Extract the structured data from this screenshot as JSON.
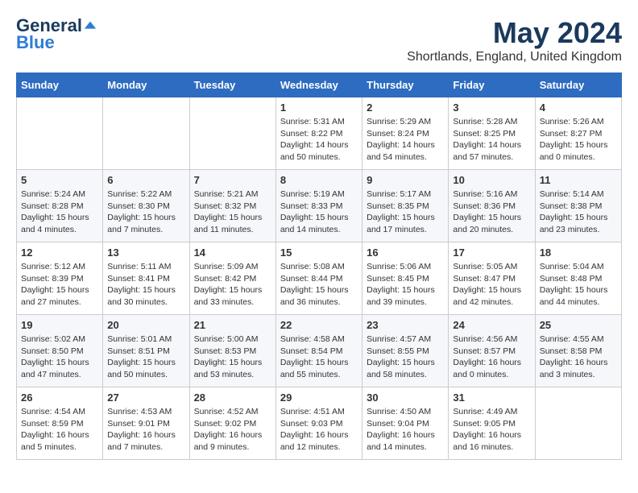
{
  "header": {
    "logo_line1": "General",
    "logo_line2": "Blue",
    "month_year": "May 2024",
    "location": "Shortlands, England, United Kingdom"
  },
  "weekdays": [
    "Sunday",
    "Monday",
    "Tuesday",
    "Wednesday",
    "Thursday",
    "Friday",
    "Saturday"
  ],
  "weeks": [
    [
      {
        "day": "",
        "info": ""
      },
      {
        "day": "",
        "info": ""
      },
      {
        "day": "",
        "info": ""
      },
      {
        "day": "1",
        "info": "Sunrise: 5:31 AM\nSunset: 8:22 PM\nDaylight: 14 hours\nand 50 minutes."
      },
      {
        "day": "2",
        "info": "Sunrise: 5:29 AM\nSunset: 8:24 PM\nDaylight: 14 hours\nand 54 minutes."
      },
      {
        "day": "3",
        "info": "Sunrise: 5:28 AM\nSunset: 8:25 PM\nDaylight: 14 hours\nand 57 minutes."
      },
      {
        "day": "4",
        "info": "Sunrise: 5:26 AM\nSunset: 8:27 PM\nDaylight: 15 hours\nand 0 minutes."
      }
    ],
    [
      {
        "day": "5",
        "info": "Sunrise: 5:24 AM\nSunset: 8:28 PM\nDaylight: 15 hours\nand 4 minutes."
      },
      {
        "day": "6",
        "info": "Sunrise: 5:22 AM\nSunset: 8:30 PM\nDaylight: 15 hours\nand 7 minutes."
      },
      {
        "day": "7",
        "info": "Sunrise: 5:21 AM\nSunset: 8:32 PM\nDaylight: 15 hours\nand 11 minutes."
      },
      {
        "day": "8",
        "info": "Sunrise: 5:19 AM\nSunset: 8:33 PM\nDaylight: 15 hours\nand 14 minutes."
      },
      {
        "day": "9",
        "info": "Sunrise: 5:17 AM\nSunset: 8:35 PM\nDaylight: 15 hours\nand 17 minutes."
      },
      {
        "day": "10",
        "info": "Sunrise: 5:16 AM\nSunset: 8:36 PM\nDaylight: 15 hours\nand 20 minutes."
      },
      {
        "day": "11",
        "info": "Sunrise: 5:14 AM\nSunset: 8:38 PM\nDaylight: 15 hours\nand 23 minutes."
      }
    ],
    [
      {
        "day": "12",
        "info": "Sunrise: 5:12 AM\nSunset: 8:39 PM\nDaylight: 15 hours\nand 27 minutes."
      },
      {
        "day": "13",
        "info": "Sunrise: 5:11 AM\nSunset: 8:41 PM\nDaylight: 15 hours\nand 30 minutes."
      },
      {
        "day": "14",
        "info": "Sunrise: 5:09 AM\nSunset: 8:42 PM\nDaylight: 15 hours\nand 33 minutes."
      },
      {
        "day": "15",
        "info": "Sunrise: 5:08 AM\nSunset: 8:44 PM\nDaylight: 15 hours\nand 36 minutes."
      },
      {
        "day": "16",
        "info": "Sunrise: 5:06 AM\nSunset: 8:45 PM\nDaylight: 15 hours\nand 39 minutes."
      },
      {
        "day": "17",
        "info": "Sunrise: 5:05 AM\nSunset: 8:47 PM\nDaylight: 15 hours\nand 42 minutes."
      },
      {
        "day": "18",
        "info": "Sunrise: 5:04 AM\nSunset: 8:48 PM\nDaylight: 15 hours\nand 44 minutes."
      }
    ],
    [
      {
        "day": "19",
        "info": "Sunrise: 5:02 AM\nSunset: 8:50 PM\nDaylight: 15 hours\nand 47 minutes."
      },
      {
        "day": "20",
        "info": "Sunrise: 5:01 AM\nSunset: 8:51 PM\nDaylight: 15 hours\nand 50 minutes."
      },
      {
        "day": "21",
        "info": "Sunrise: 5:00 AM\nSunset: 8:53 PM\nDaylight: 15 hours\nand 53 minutes."
      },
      {
        "day": "22",
        "info": "Sunrise: 4:58 AM\nSunset: 8:54 PM\nDaylight: 15 hours\nand 55 minutes."
      },
      {
        "day": "23",
        "info": "Sunrise: 4:57 AM\nSunset: 8:55 PM\nDaylight: 15 hours\nand 58 minutes."
      },
      {
        "day": "24",
        "info": "Sunrise: 4:56 AM\nSunset: 8:57 PM\nDaylight: 16 hours\nand 0 minutes."
      },
      {
        "day": "25",
        "info": "Sunrise: 4:55 AM\nSunset: 8:58 PM\nDaylight: 16 hours\nand 3 minutes."
      }
    ],
    [
      {
        "day": "26",
        "info": "Sunrise: 4:54 AM\nSunset: 8:59 PM\nDaylight: 16 hours\nand 5 minutes."
      },
      {
        "day": "27",
        "info": "Sunrise: 4:53 AM\nSunset: 9:01 PM\nDaylight: 16 hours\nand 7 minutes."
      },
      {
        "day": "28",
        "info": "Sunrise: 4:52 AM\nSunset: 9:02 PM\nDaylight: 16 hours\nand 9 minutes."
      },
      {
        "day": "29",
        "info": "Sunrise: 4:51 AM\nSunset: 9:03 PM\nDaylight: 16 hours\nand 12 minutes."
      },
      {
        "day": "30",
        "info": "Sunrise: 4:50 AM\nSunset: 9:04 PM\nDaylight: 16 hours\nand 14 minutes."
      },
      {
        "day": "31",
        "info": "Sunrise: 4:49 AM\nSunset: 9:05 PM\nDaylight: 16 hours\nand 16 minutes."
      },
      {
        "day": "",
        "info": ""
      }
    ]
  ]
}
